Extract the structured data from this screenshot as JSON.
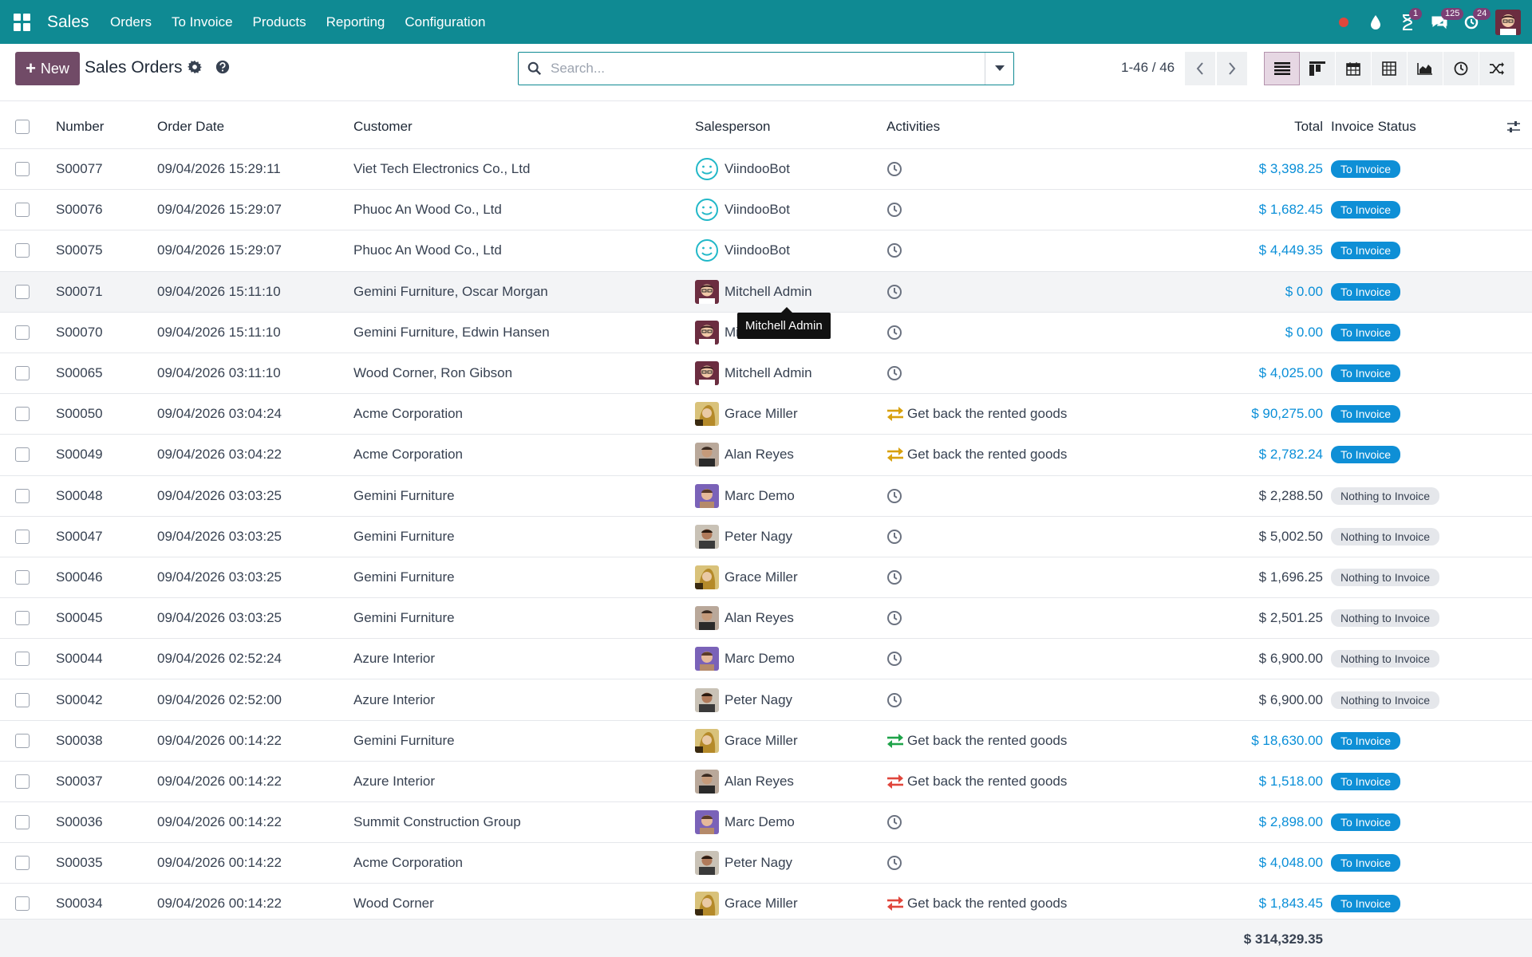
{
  "navbar": {
    "app_name": "Sales",
    "menu": [
      "Orders",
      "To Invoice",
      "Products",
      "Reporting",
      "Configuration"
    ],
    "badges": {
      "activity": "1",
      "messages": "125",
      "updates": "24"
    }
  },
  "control": {
    "new_label": "New",
    "breadcrumb": "Sales Orders",
    "search_placeholder": "Search...",
    "pager": "1-46 / 46"
  },
  "table": {
    "headers": {
      "number": "Number",
      "date": "Order Date",
      "customer": "Customer",
      "salesperson": "Salesperson",
      "activities": "Activities",
      "total": "Total",
      "status": "Invoice Status"
    },
    "rows": [
      {
        "number": "S00077",
        "date": "09/04/2026 15:29:11",
        "customer": "Viet Tech Electronics Co., Ltd",
        "salesperson": "ViindooBot",
        "avatar": "bot",
        "activity": "",
        "activity_icon": "clock",
        "total": "$ 3,398.25",
        "status": "To Invoice"
      },
      {
        "number": "S00076",
        "date": "09/04/2026 15:29:07",
        "customer": "Phuoc An Wood Co., Ltd",
        "salesperson": "ViindooBot",
        "avatar": "bot",
        "activity": "",
        "activity_icon": "clock",
        "total": "$ 1,682.45",
        "status": "To Invoice"
      },
      {
        "number": "S00075",
        "date": "09/04/2026 15:29:07",
        "customer": "Phuoc An Wood Co., Ltd",
        "salesperson": "ViindooBot",
        "avatar": "bot",
        "activity": "",
        "activity_icon": "clock",
        "total": "$ 4,449.35",
        "status": "To Invoice"
      },
      {
        "number": "S00071",
        "date": "09/04/2026 15:11:10",
        "customer": "Gemini Furniture, Oscar Morgan",
        "salesperson": "Mitchell Admin",
        "avatar": "mitchell",
        "activity": "",
        "activity_icon": "clock",
        "total": "$ 0.00",
        "status": "To Invoice"
      },
      {
        "number": "S00070",
        "date": "09/04/2026 15:11:10",
        "customer": "Gemini Furniture, Edwin Hansen",
        "salesperson": "Mitchell Admin",
        "avatar": "mitchell",
        "activity": "",
        "activity_icon": "clock",
        "total": "$ 0.00",
        "status": "To Invoice"
      },
      {
        "number": "S00065",
        "date": "09/04/2026 03:11:10",
        "customer": "Wood Corner, Ron Gibson",
        "salesperson": "Mitchell Admin",
        "avatar": "mitchell",
        "activity": "",
        "activity_icon": "clock",
        "total": "$ 4,025.00",
        "status": "To Invoice"
      },
      {
        "number": "S00050",
        "date": "09/04/2026 03:04:24",
        "customer": "Acme Corporation",
        "salesperson": "Grace Miller",
        "avatar": "grace",
        "activity": "Get back the rented goods",
        "activity_icon": "exchange-orange",
        "total": "$ 90,275.00",
        "status": "To Invoice"
      },
      {
        "number": "S00049",
        "date": "09/04/2026 03:04:22",
        "customer": "Acme Corporation",
        "salesperson": "Alan Reyes",
        "avatar": "alan",
        "activity": "Get back the rented goods",
        "activity_icon": "exchange-orange",
        "total": "$ 2,782.24",
        "status": "To Invoice"
      },
      {
        "number": "S00048",
        "date": "09/04/2026 03:03:25",
        "customer": "Gemini Furniture",
        "salesperson": "Marc Demo",
        "avatar": "marc",
        "activity": "",
        "activity_icon": "clock",
        "total": "$ 2,288.50",
        "status": "Nothing to Invoice"
      },
      {
        "number": "S00047",
        "date": "09/04/2026 03:03:25",
        "customer": "Gemini Furniture",
        "salesperson": "Peter Nagy",
        "avatar": "peter",
        "activity": "",
        "activity_icon": "clock",
        "total": "$ 5,002.50",
        "status": "Nothing to Invoice"
      },
      {
        "number": "S00046",
        "date": "09/04/2026 03:03:25",
        "customer": "Gemini Furniture",
        "salesperson": "Grace Miller",
        "avatar": "grace",
        "activity": "",
        "activity_icon": "clock",
        "total": "$ 1,696.25",
        "status": "Nothing to Invoice"
      },
      {
        "number": "S00045",
        "date": "09/04/2026 03:03:25",
        "customer": "Gemini Furniture",
        "salesperson": "Alan Reyes",
        "avatar": "alan",
        "activity": "",
        "activity_icon": "clock",
        "total": "$ 2,501.25",
        "status": "Nothing to Invoice"
      },
      {
        "number": "S00044",
        "date": "09/04/2026 02:52:24",
        "customer": "Azure Interior",
        "salesperson": "Marc Demo",
        "avatar": "marc",
        "activity": "",
        "activity_icon": "clock",
        "total": "$ 6,900.00",
        "status": "Nothing to Invoice"
      },
      {
        "number": "S00042",
        "date": "09/04/2026 02:52:00",
        "customer": "Azure Interior",
        "salesperson": "Peter Nagy",
        "avatar": "peter",
        "activity": "",
        "activity_icon": "clock",
        "total": "$ 6,900.00",
        "status": "Nothing to Invoice"
      },
      {
        "number": "S00038",
        "date": "09/04/2026 00:14:22",
        "customer": "Gemini Furniture",
        "salesperson": "Grace Miller",
        "avatar": "grace",
        "activity": "Get back the rented goods",
        "activity_icon": "exchange-green",
        "total": "$ 18,630.00",
        "status": "To Invoice"
      },
      {
        "number": "S00037",
        "date": "09/04/2026 00:14:22",
        "customer": "Azure Interior",
        "salesperson": "Alan Reyes",
        "avatar": "alan",
        "activity": "Get back the rented goods",
        "activity_icon": "exchange-red",
        "total": "$ 1,518.00",
        "status": "To Invoice"
      },
      {
        "number": "S00036",
        "date": "09/04/2026 00:14:22",
        "customer": "Summit Construction Group",
        "salesperson": "Marc Demo",
        "avatar": "marc",
        "activity": "",
        "activity_icon": "clock",
        "total": "$ 2,898.00",
        "status": "To Invoice"
      },
      {
        "number": "S00035",
        "date": "09/04/2026 00:14:22",
        "customer": "Acme Corporation",
        "salesperson": "Peter Nagy",
        "avatar": "peter",
        "activity": "",
        "activity_icon": "clock",
        "total": "$ 4,048.00",
        "status": "To Invoice"
      },
      {
        "number": "S00034",
        "date": "09/04/2026 00:14:22",
        "customer": "Wood Corner",
        "salesperson": "Grace Miller",
        "avatar": "grace",
        "activity": "Get back the rented goods",
        "activity_icon": "exchange-red",
        "total": "$ 1,843.45",
        "status": "To Invoice"
      }
    ],
    "footer_total": "$ 314,329.35"
  },
  "tooltip": {
    "text": "Mitchell Admin"
  },
  "colors": {
    "navbar": "#0f8a93",
    "primary": "#714b67",
    "link": "#0a8fd8",
    "badge_blue": "#0e8fd6",
    "badge_gray": "#e5e7eb",
    "exchange_orange": "#d8a10e",
    "exchange_green": "#1fa34a",
    "exchange_red": "#e0463c"
  }
}
